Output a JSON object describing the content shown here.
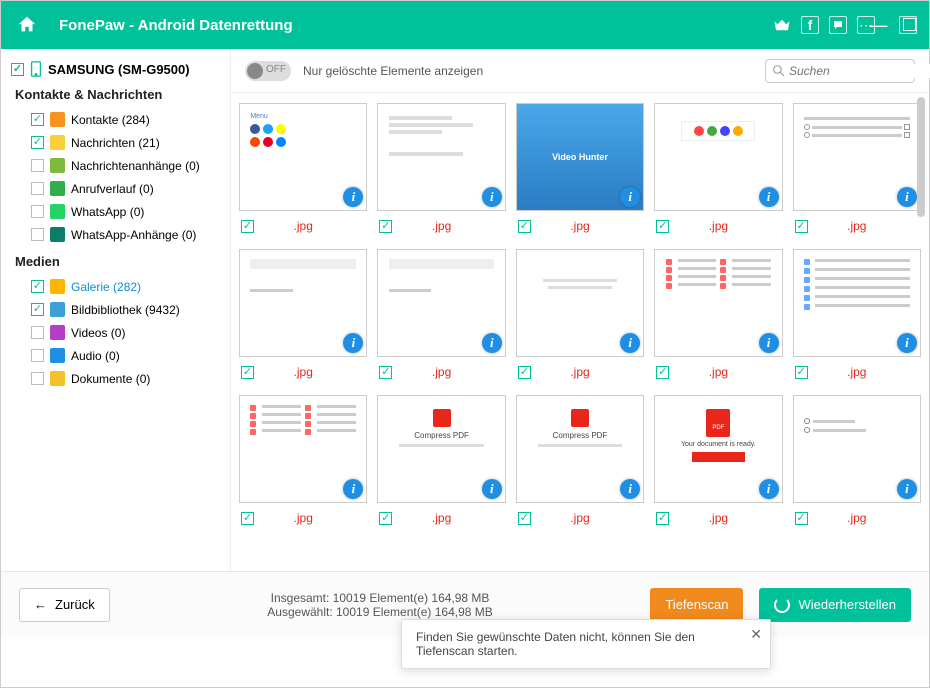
{
  "app": {
    "title": "FonePaw - Android Datenrettung"
  },
  "device": {
    "name": "SAMSUNG (SM-G9500)"
  },
  "sidebar": {
    "group1_title": "Kontakte & Nachrichten",
    "group2_title": "Medien",
    "items": [
      {
        "label": "Kontakte (284)",
        "checked": true,
        "icon": "#f7931e"
      },
      {
        "label": "Nachrichten (21)",
        "checked": true,
        "icon": "#f9cf3a"
      },
      {
        "label": "Nachrichtenanhänge (0)",
        "checked": false,
        "icon": "#7cbb3f"
      },
      {
        "label": "Anrufverlauf (0)",
        "checked": false,
        "icon": "#2fae4b"
      },
      {
        "label": "WhatsApp (0)",
        "checked": false,
        "icon": "#25d366"
      },
      {
        "label": "WhatsApp-Anhänge (0)",
        "checked": false,
        "icon": "#0d7d6b"
      },
      {
        "label": "Galerie (282)",
        "checked": true,
        "icon": "#ffb400",
        "active": true
      },
      {
        "label": "Bildbibliothek (9432)",
        "checked": true,
        "icon": "#3aa0d6"
      },
      {
        "label": "Videos (0)",
        "checked": false,
        "icon": "#b23fc4"
      },
      {
        "label": "Audio (0)",
        "checked": false,
        "icon": "#1f8fe6"
      },
      {
        "label": "Dokumente (0)",
        "checked": false,
        "icon": "#f3c22b"
      }
    ]
  },
  "toolbar": {
    "toggle_label": "OFF",
    "toggle_text": "Nur gelöschte Elemente anzeigen",
    "search_placeholder": "Suchen"
  },
  "grid": {
    "ext": ".jpg",
    "count": 15
  },
  "footer": {
    "back": "Zurück",
    "stats_total": "Insgesamt: 10019 Element(e) 164,98 MB",
    "stats_sel": "Ausgewählt: 10019 Element(e) 164,98 MB",
    "deep": "Tiefenscan",
    "recover": "Wiederherstellen"
  },
  "tip": "Finden Sie gewünschte Daten nicht, können Sie den Tiefenscan starten."
}
